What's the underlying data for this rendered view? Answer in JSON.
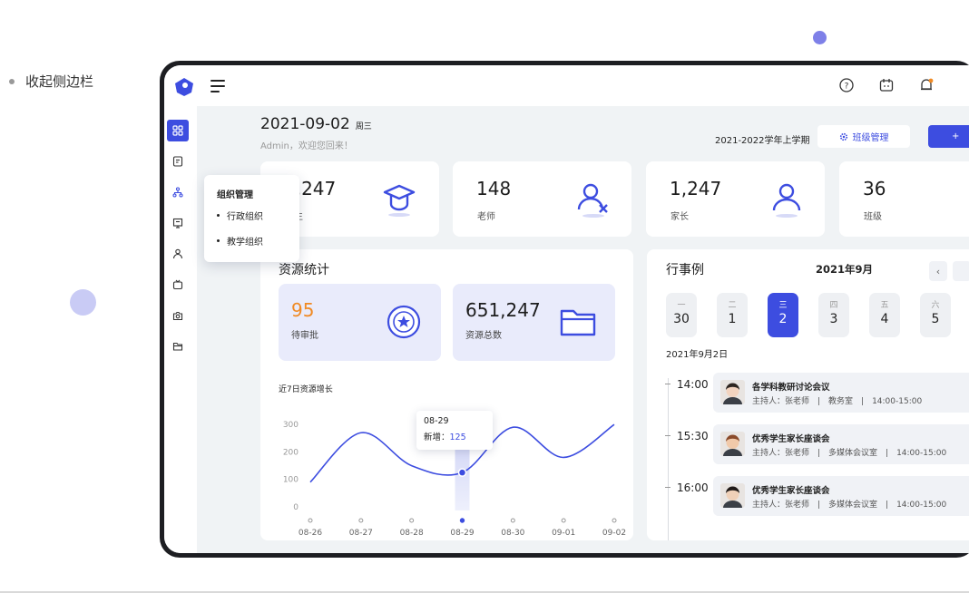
{
  "caption": {
    "text": "收起侧边栏"
  },
  "header": {
    "date": "2021-09-02",
    "weekday": "周三",
    "welcome": "Admin，欢迎您回来！",
    "term": "2021-2022学年上学期",
    "class_button": "班级管理"
  },
  "sidebar": {
    "items": [
      {
        "icon": "dashboard-icon"
      },
      {
        "icon": "document-icon"
      },
      {
        "icon": "org-tree-icon"
      },
      {
        "icon": "book-icon"
      },
      {
        "icon": "user-icon"
      },
      {
        "icon": "tv-icon"
      },
      {
        "icon": "camera-icon"
      },
      {
        "icon": "folder-icon"
      }
    ]
  },
  "popover": {
    "title": "组织管理",
    "items": [
      "行政组织",
      "教学组织"
    ]
  },
  "stats": [
    {
      "value": "1,247",
      "label": "学生",
      "icon": "graduation-icon"
    },
    {
      "value": "148",
      "label": "老师",
      "icon": "teacher-icon"
    },
    {
      "value": "1,247",
      "label": "家长",
      "icon": "parent-icon"
    },
    {
      "value": "36",
      "label": "班级",
      "icon": "class-icon"
    }
  ],
  "resources": {
    "title": "资源统计",
    "pending": {
      "value": "95",
      "label": "待审批"
    },
    "total": {
      "value": "651,247",
      "label": "资源总数"
    },
    "chart_title": "近7日资源增长",
    "tooltip": {
      "date": "08-29",
      "label": "新增：",
      "value": "125"
    }
  },
  "chart_data": {
    "type": "line",
    "title": "近7日资源增长",
    "categories": [
      "08-26",
      "08-27",
      "08-28",
      "08-29",
      "08-30",
      "09-01",
      "09-02"
    ],
    "yticks": [
      "0",
      "100",
      "200",
      "300"
    ],
    "ylim": [
      0,
      350
    ],
    "values": [
      90,
      270,
      150,
      125,
      290,
      180,
      300
    ],
    "highlight_index": 3,
    "color": "#3d4de0"
  },
  "calendar": {
    "title": "行事例",
    "month": "2021年9月",
    "selected_label": "2021年9月2日",
    "days": [
      {
        "weekday": "一",
        "day": "30",
        "selected": false
      },
      {
        "weekday": "二",
        "day": "1",
        "selected": false
      },
      {
        "weekday": "三",
        "day": "2",
        "selected": true
      },
      {
        "weekday": "四",
        "day": "3",
        "selected": false
      },
      {
        "weekday": "五",
        "day": "4",
        "selected": false
      },
      {
        "weekday": "六",
        "day": "5",
        "selected": false
      }
    ],
    "events": [
      {
        "time": "14:00",
        "title": "各学科教研讨论会议",
        "meta": "主持人：张老师　|　教务室　|　14:00-15:00"
      },
      {
        "time": "15:30",
        "title": "优秀学生家长座谈会",
        "meta": "主持人：张老师　|　多媒体会议室　|　14:00-15:00"
      },
      {
        "time": "16:00",
        "title": "优秀学生家长座谈会",
        "meta": "主持人：张老师　|　多媒体会议室　|　14:00-15:00"
      }
    ]
  },
  "colors": {
    "accent": "#3d4de0",
    "orange": "#f08a24"
  }
}
